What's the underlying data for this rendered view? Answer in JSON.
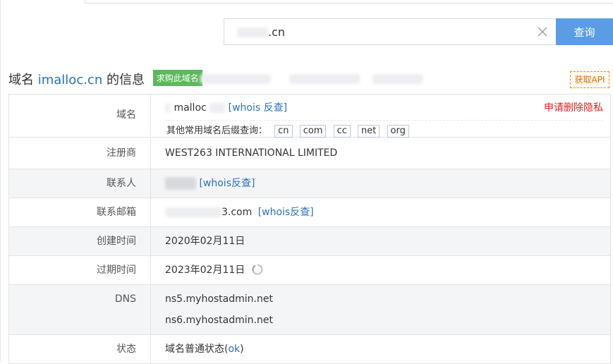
{
  "search": {
    "value": ".cn",
    "button_label": "查询"
  },
  "header": {
    "title_prefix": "域名",
    "domain": "imalloc.cn",
    "title_suffix": "的信息",
    "buy_badge": "求购此域名",
    "api_button": "获取API"
  },
  "domain_row": {
    "label": "域名",
    "domain_value": "malloc",
    "whois_link": "[whois 反查]",
    "privacy_link": "申请删除隐私",
    "suffix_label": "其他常用域名后缀查询：",
    "suffixes": [
      "cn",
      "com",
      "cc",
      "net",
      "org"
    ]
  },
  "registrar_row": {
    "label": "注册商",
    "value": "WEST263 INTERNATIONAL LIMITED"
  },
  "contact_row": {
    "label": "联系人",
    "whois_link": "[whois反查]"
  },
  "email_row": {
    "label": "联系邮箱",
    "value": "3.com",
    "whois_link": "[whois反查]"
  },
  "created_row": {
    "label": "创建时间",
    "value": "2020年02月11日"
  },
  "expire_row": {
    "label": "过期时间",
    "value": "2023年02月11日"
  },
  "dns_row": {
    "label": "DNS",
    "servers": [
      "ns5.myhostadmin.net",
      "ns6.myhostadmin.net"
    ]
  },
  "status_row": {
    "label": "状态",
    "value": "域名普通状态(",
    "ok": "ok",
    "close": ")"
  },
  "colors": {
    "accent": "#5b9de5",
    "link": "#2a70b8",
    "badge": "#5cb85c",
    "danger": "#e02020",
    "api": "#e66d00"
  }
}
